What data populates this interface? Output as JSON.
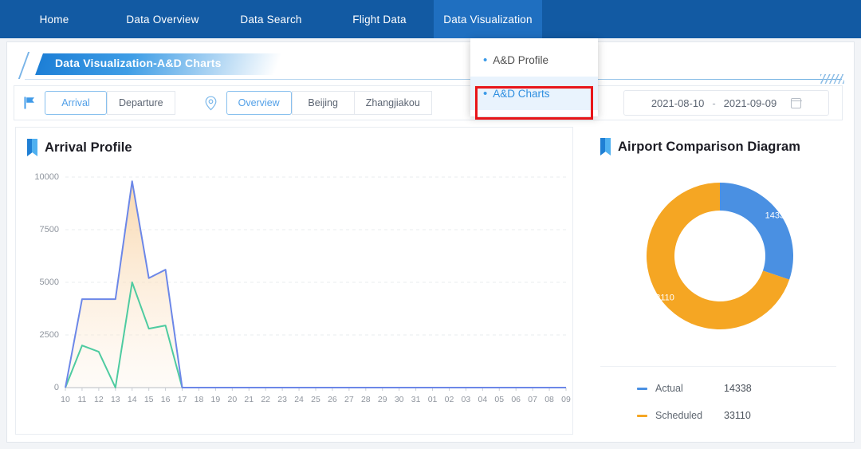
{
  "nav": {
    "items": [
      {
        "label": "Home",
        "active": false
      },
      {
        "label": "Data Overview",
        "active": false
      },
      {
        "label": "Data Search",
        "active": false
      },
      {
        "label": "Flight Data",
        "active": false
      },
      {
        "label": "Data Visualization",
        "active": true
      }
    ]
  },
  "dropdown": {
    "items": [
      {
        "label": "A&D Profile",
        "selected": false
      },
      {
        "label": "A&D Charts",
        "selected": true
      }
    ],
    "highlight_color": "#e8161a"
  },
  "banner": {
    "title": "Data Visualization-A&D Charts"
  },
  "toolbar": {
    "flag_icon": "flag-icon",
    "direction": {
      "options": [
        {
          "label": "Arrival",
          "active": true
        },
        {
          "label": "Departure",
          "active": false
        }
      ]
    },
    "location_icon": "location-pin-icon",
    "airports": {
      "options": [
        {
          "label": "Overview",
          "active": true
        },
        {
          "label": "Beijing",
          "active": false
        },
        {
          "label": "Zhangjiakou",
          "active": false
        }
      ]
    },
    "date_range": {
      "start": "2021-08-10",
      "separator": "-",
      "end": "2021-09-09",
      "calendar_icon": "calendar-icon"
    }
  },
  "panels": {
    "left_title": "Arrival Profile",
    "right_title": "Airport Comparison Diagram"
  },
  "legend": {
    "rows": [
      {
        "name": "Actual",
        "value": "14338",
        "color": "#4a90e2"
      },
      {
        "name": "Scheduled",
        "value": "33110",
        "color": "#f5a623"
      }
    ]
  },
  "chart_data": [
    {
      "type": "area",
      "title": "Arrival Profile",
      "xlabel": "",
      "ylabel": "",
      "ylim": [
        0,
        10000
      ],
      "yticks": [
        0,
        2500,
        5000,
        7500,
        10000
      ],
      "grid": true,
      "legend_position": "none",
      "categories": [
        "10",
        "11",
        "12",
        "13",
        "14",
        "15",
        "16",
        "17",
        "18",
        "19",
        "20",
        "21",
        "22",
        "23",
        "24",
        "25",
        "26",
        "27",
        "28",
        "29",
        "30",
        "31",
        "01",
        "02",
        "03",
        "04",
        "05",
        "06",
        "07",
        "08",
        "09"
      ],
      "series": [
        {
          "name": "Scheduled",
          "color": "#6c87e8",
          "values": [
            0,
            4200,
            4200,
            4200,
            9800,
            5200,
            5600,
            0,
            0,
            0,
            0,
            0,
            0,
            0,
            0,
            0,
            0,
            0,
            0,
            0,
            0,
            0,
            0,
            0,
            0,
            0,
            0,
            0,
            0,
            0,
            0
          ]
        },
        {
          "name": "Actual",
          "color": "#4ecba0",
          "values": [
            0,
            2000,
            1700,
            0,
            5000,
            2800,
            2950,
            0,
            0,
            0,
            0,
            0,
            0,
            0,
            0,
            0,
            0,
            0,
            0,
            0,
            0,
            0,
            0,
            0,
            0,
            0,
            0,
            0,
            0,
            0,
            0
          ]
        }
      ]
    },
    {
      "type": "pie",
      "title": "Airport Comparison Diagram",
      "donut": true,
      "labels": [
        "Actual",
        "Scheduled"
      ],
      "values": [
        14338,
        33110
      ],
      "colors": [
        "#4a90e2",
        "#f5a623"
      ],
      "legend_position": "bottom",
      "data_labels": [
        "14338",
        "33110"
      ]
    }
  ]
}
